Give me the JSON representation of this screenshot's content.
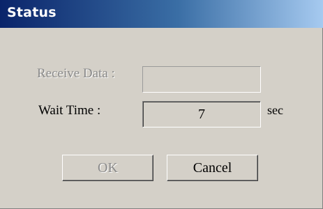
{
  "window": {
    "title": "Status"
  },
  "fields": {
    "receive_data": {
      "label": "Receive Data :",
      "value": ""
    },
    "wait_time": {
      "label": "Wait Time :",
      "value": "7",
      "unit": "sec"
    }
  },
  "buttons": {
    "ok_label": "OK",
    "cancel_label": "Cancel"
  },
  "colors": {
    "titlebar_start": "#0a246a",
    "titlebar_end": "#a6caf0",
    "face": "#d4d0c8",
    "disabled_text": "#8a8a8a"
  }
}
